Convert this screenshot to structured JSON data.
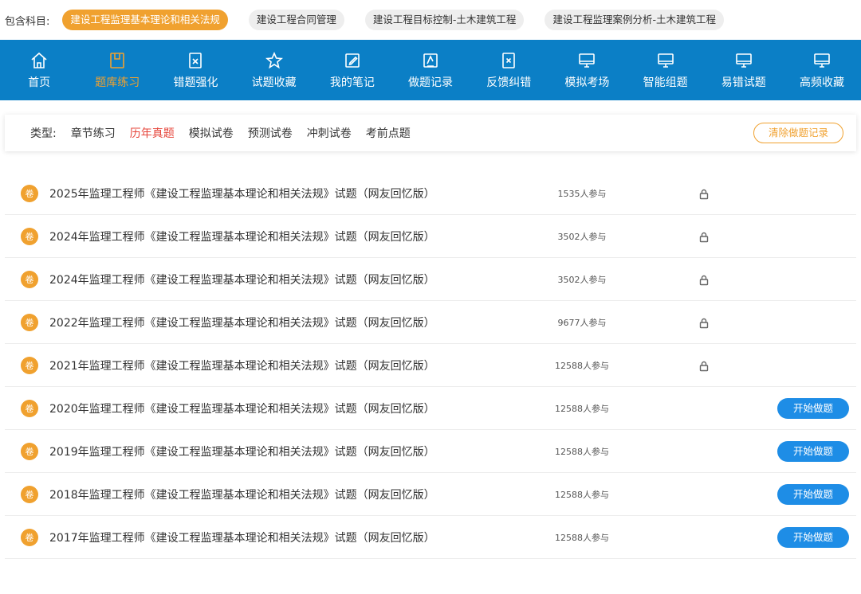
{
  "subjects": {
    "label": "包含科目:",
    "items": [
      {
        "label": "建设工程监理基本理论和相关法规",
        "active": true
      },
      {
        "label": "建设工程合同管理",
        "active": false
      },
      {
        "label": "建设工程目标控制-土木建筑工程",
        "active": false
      },
      {
        "label": "建设工程监理案例分析-土木建筑工程",
        "active": false
      }
    ]
  },
  "nav": {
    "items": [
      {
        "label": "首页",
        "icon": "home-icon"
      },
      {
        "label": "题库练习",
        "icon": "bank-icon",
        "active": true
      },
      {
        "label": "错题强化",
        "icon": "wrong-icon"
      },
      {
        "label": "试题收藏",
        "icon": "star-icon"
      },
      {
        "label": "我的笔记",
        "icon": "edit-icon"
      },
      {
        "label": "做题记录",
        "icon": "record-icon"
      },
      {
        "label": "反馈纠错",
        "icon": "feedback-icon"
      },
      {
        "label": "模拟考场",
        "icon": "monitor-icon"
      },
      {
        "label": "智能组题",
        "icon": "monitor-icon"
      },
      {
        "label": "易错试题",
        "icon": "monitor-icon"
      },
      {
        "label": "高频收藏",
        "icon": "monitor-icon"
      }
    ]
  },
  "filter": {
    "label": "类型:",
    "tabs": [
      "章节练习",
      "历年真题",
      "模拟试卷",
      "预测试卷",
      "冲刺试卷",
      "考前点题"
    ],
    "active_index": 1,
    "clear_label": "清除做题记录"
  },
  "papers": {
    "badge": "卷",
    "start_label": "开始做题",
    "rows": [
      {
        "title": "2025年监理工程师《建设工程监理基本理论和相关法规》试题（网友回忆版）",
        "count": "1535人参与",
        "locked": true
      },
      {
        "title": "2024年监理工程师《建设工程监理基本理论和相关法规》试题（网友回忆版）",
        "count": "3502人参与",
        "locked": true
      },
      {
        "title": "2024年监理工程师《建设工程监理基本理论和相关法规》试题（网友回忆版）",
        "count": "3502人参与",
        "locked": true
      },
      {
        "title": "2022年监理工程师《建设工程监理基本理论和相关法规》试题（网友回忆版）",
        "count": "9677人参与",
        "locked": true
      },
      {
        "title": "2021年监理工程师《建设工程监理基本理论和相关法规》试题（网友回忆版）",
        "count": "12588人参与",
        "locked": true
      },
      {
        "title": "2020年监理工程师《建设工程监理基本理论和相关法规》试题（网友回忆版）",
        "count": "12588人参与",
        "locked": false
      },
      {
        "title": "2019年监理工程师《建设工程监理基本理论和相关法规》试题（网友回忆版）",
        "count": "12588人参与",
        "locked": false
      },
      {
        "title": "2018年监理工程师《建设工程监理基本理论和相关法规》试题（网友回忆版）",
        "count": "12588人参与",
        "locked": false
      },
      {
        "title": "2017年监理工程师《建设工程监理基本理论和相关法规》试题（网友回忆版）",
        "count": "12588人参与",
        "locked": false
      }
    ]
  }
}
